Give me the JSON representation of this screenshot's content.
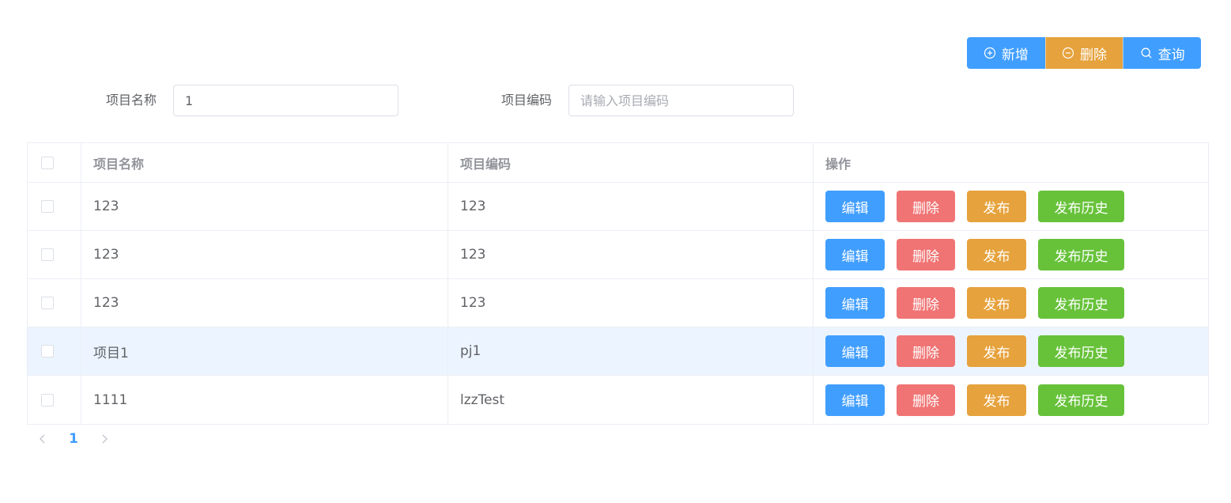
{
  "toolbar": {
    "add_label": "新增",
    "delete_label": "删除",
    "query_label": "查询"
  },
  "search": {
    "name_label": "项目名称",
    "name_value": "1",
    "code_label": "项目编码",
    "code_placeholder": "请输入项目编码"
  },
  "table": {
    "headers": {
      "name": "项目名称",
      "code": "项目编码",
      "ops": "操作"
    },
    "rows": [
      {
        "name": "123",
        "code": "123"
      },
      {
        "name": "123",
        "code": "123"
      },
      {
        "name": "123",
        "code": "123"
      },
      {
        "name": "项目1",
        "code": "pj1"
      },
      {
        "name": "1111",
        "code": "lzzTest"
      }
    ],
    "actions": {
      "edit": "编辑",
      "delete": "删除",
      "publish": "发布",
      "history": "发布历史"
    }
  },
  "pagination": {
    "current_page": "1"
  },
  "colors": {
    "primary": "#409eff",
    "warning": "#e6a23c",
    "danger": "#f07474",
    "success": "#67c23a",
    "row_highlight": "#ecf5ff"
  }
}
